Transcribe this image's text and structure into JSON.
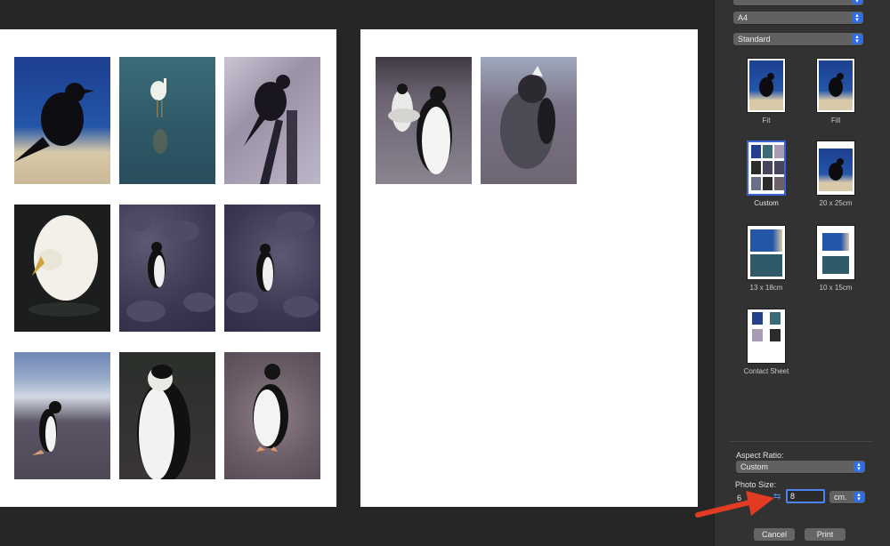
{
  "sidebar": {
    "paper_size": "A4",
    "quality": "Standard",
    "layouts": [
      {
        "label": "Fit"
      },
      {
        "label": "Fill"
      },
      {
        "label": "Custom"
      },
      {
        "label": "20 x 25cm"
      },
      {
        "label": "13 x 18cm"
      },
      {
        "label": "10 x 15cm"
      },
      {
        "label": "Contact Sheet"
      }
    ],
    "aspect_ratio_label": "Aspect Ratio:",
    "aspect_ratio_value": "Custom",
    "photo_size_label": "Photo Size:",
    "photo_width": "6",
    "photo_height": "8",
    "unit": "cm.",
    "cancel_label": "Cancel",
    "print_label": "Print"
  },
  "colors": {
    "accent": "#2f6ee6",
    "arrow": "#e33b22"
  }
}
